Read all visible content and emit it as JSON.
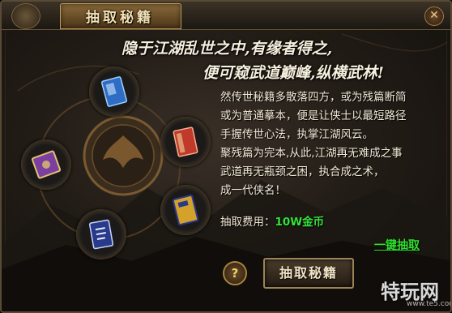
{
  "window": {
    "title": "抽取秘籍",
    "close_glyph": "✕"
  },
  "headline": {
    "line1": "隐于江湖乱世之中,有缘者得之,",
    "line2": "便可窥武道巅峰,纵横武林!"
  },
  "description": {
    "lines": [
      "然传世秘籍多散落四方，或为残篇断简",
      "或为普通摹本，便是让侠士以最短路径",
      "手握传世心法，执掌江湖风云。",
      "聚残篇为完本,从此,江湖再无难成之事",
      "武道再无瓶颈之困，执合成之术，",
      "成一代侠名！"
    ]
  },
  "cost": {
    "label": "抽取费用：",
    "value": "10W金币"
  },
  "buttons": {
    "one_click": "一键抽取",
    "draw": "抽取秘籍",
    "help": "?"
  },
  "slots": [
    {
      "icon": "blue-book-icon",
      "color": "#2f6cc4"
    },
    {
      "icon": "red-book-icon",
      "color": "#c0392b"
    },
    {
      "icon": "purple-book-icon",
      "color": "#7b3fa0"
    },
    {
      "icon": "yellow-book-icon",
      "color": "#d4a22a"
    },
    {
      "icon": "dark-blue-book-icon",
      "color": "#2a3a8a"
    }
  ],
  "watermark": {
    "text": "特玩网",
    "sub": "www.te5.com"
  }
}
